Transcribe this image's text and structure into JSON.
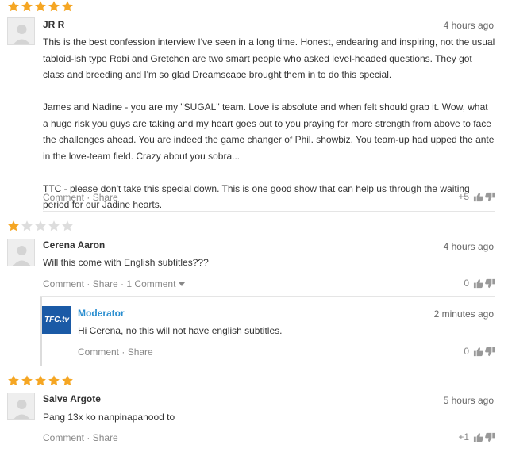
{
  "comments": [
    {
      "rating": 5,
      "author": "JR R",
      "time": "4 hours ago",
      "paragraphs": [
        "This is the best confession interview I've seen in a long time. Honest, endearing and inspiring, not the usual tabloid-ish type Robi and Gretchen are two smart people who asked level-headed questions. They got class and breeding and I'm so glad Dreamscape brought them in to do this special.",
        "James and Nadine - you are my \"SUGAL\" team. Love is absolute and when felt should grab it.  Wow, what a huge risk you guys are taking and my heart goes out to you praying for more strength from above to face the challenges ahead.  You are indeed the game changer of Phil. showbiz. You team-up had upped the ante in the love-team field.  Crazy about you sobra...",
        "TTC - please don't take this special down. This is one good show that can help us through the waiting period for our Jadine hearts."
      ],
      "comment_label": "Comment",
      "share_label": "Share",
      "votes": "+5"
    },
    {
      "rating": 1,
      "author": "Cerena Aaron",
      "time": "4 hours ago",
      "text": "Will this come with English subtitles???",
      "comment_label": "Comment",
      "share_label": "Share",
      "replies_label": "1 Comment",
      "votes": "0",
      "reply": {
        "logo_text": "TFC.tv",
        "author": "Moderator",
        "time": "2 minutes ago",
        "text": "Hi Cerena, no this will not have english subtitles.",
        "comment_label": "Comment",
        "share_label": "Share",
        "votes": "0"
      }
    },
    {
      "rating": 5,
      "author": "Salve Argote",
      "time": "5 hours ago",
      "text": "Pang 13x ko nanpinapanood to",
      "comment_label": "Comment",
      "share_label": "Share",
      "votes": "+1"
    }
  ],
  "colors": {
    "star_filled": "#f5a623",
    "star_empty": "#dddddd",
    "moderator": "#2a8ed0",
    "tfc_logo_bg": "#1a5aa6"
  }
}
